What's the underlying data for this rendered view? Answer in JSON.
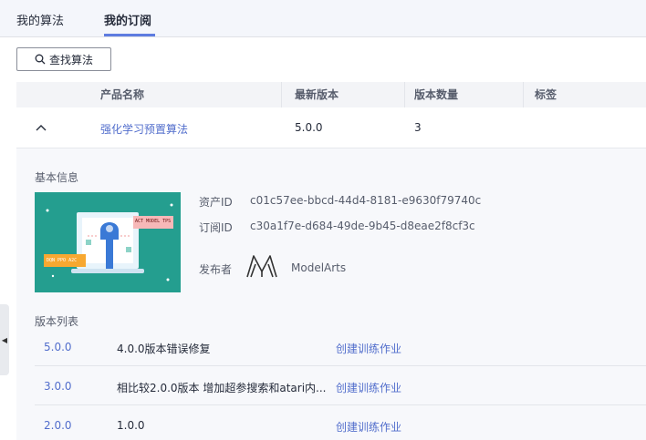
{
  "tabs": [
    {
      "label": "我的算法",
      "active": false
    },
    {
      "label": "我的订阅",
      "active": true
    }
  ],
  "search_button": {
    "label": "查找算法",
    "icon": "search-icon"
  },
  "table": {
    "headers": [
      "产品名称",
      "最新版本",
      "版本数量",
      "标签"
    ],
    "rows": [
      {
        "name": "强化学习预置算法",
        "latest_version": "5.0.0",
        "version_count": "3",
        "tags": ""
      }
    ]
  },
  "detail": {
    "basic_info_title": "基本信息",
    "thumbnail_labels": {
      "top": "ACT MODEL TPS",
      "bottom": "DQN PPO A2C"
    },
    "asset_id_label": "资产ID",
    "asset_id": "c01c57ee-bbcd-44d4-8181-e9630f79740c",
    "subscription_id_label": "订阅ID",
    "subscription_id": "c30a1f7e-d684-49de-9b45-d8eae2f8cf3c",
    "publisher_label": "发布者",
    "publisher": "ModelArts",
    "version_list_title": "版本列表",
    "versions": [
      {
        "version": "5.0.0",
        "desc": "4.0.0版本错误修复",
        "action": "创建训练作业"
      },
      {
        "version": "3.0.0",
        "desc": "相比较2.0.0版本 增加超参搜索和atari内...",
        "action": "创建训练作业"
      },
      {
        "version": "2.0.0",
        "desc": "1.0.0",
        "action": "创建训练作业"
      }
    ]
  },
  "colors": {
    "accent": "#5e7ce0",
    "link": "#526ecc",
    "thumb_bg": "#249e8f"
  }
}
